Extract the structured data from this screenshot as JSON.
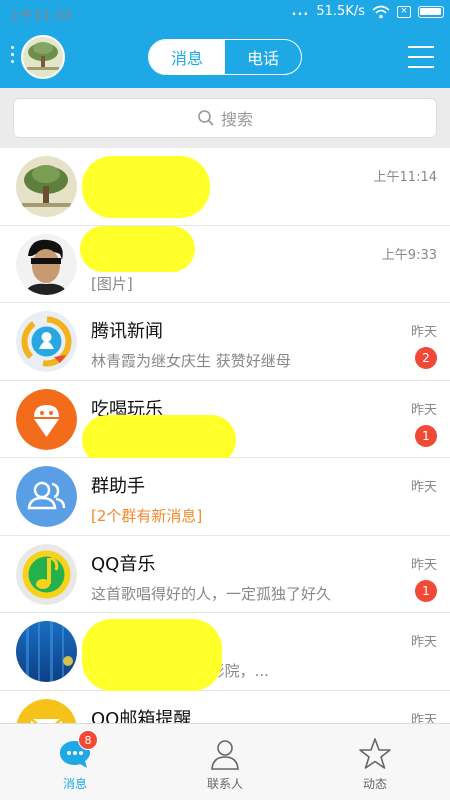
{
  "statusbar": {
    "time": "上午11:33",
    "dots": "...",
    "speed": "51.5K/s",
    "sim": "×"
  },
  "header": {
    "tabs": [
      {
        "label": "消息",
        "active": true
      },
      {
        "label": "电话",
        "active": false
      }
    ],
    "menu_icon": "menu-dots-icon",
    "more_icon": "hamburger-icon"
  },
  "search": {
    "placeholder": "搜索",
    "icon": "search-icon"
  },
  "conversations": [
    {
      "name": "",
      "preview": "",
      "time": "上午11:14",
      "badge": "",
      "avatar": "tree-avatar"
    },
    {
      "name": "",
      "preview": "[图片]",
      "time": "上午9:33",
      "badge": "",
      "avatar": "masked-man-avatar"
    },
    {
      "name": "腾讯新闻",
      "preview": "林青霞为继女庆生 获赞好继母",
      "time": "昨天",
      "badge": "2",
      "avatar": "tencent-news-avatar"
    },
    {
      "name": "吃喝玩乐",
      "preview": "",
      "time": "昨天",
      "badge": "1",
      "avatar": "ice-cream-avatar"
    },
    {
      "name": "群助手",
      "preview": "[2个群有新消息]",
      "time": "昨天",
      "badge": "",
      "avatar": "group-helper-avatar"
    },
    {
      "name": "QQ音乐",
      "preview": "这首歌唱得好的人，一定孤独了好久",
      "time": "昨天",
      "badge": "1",
      "avatar": "qq-music-avatar"
    },
    {
      "name": "",
      "preview": "2月13号一定别进影院，...",
      "time": "昨天",
      "badge": "",
      "avatar": "blue-avatar"
    },
    {
      "name": "QQ邮箱提醒",
      "preview": "",
      "time": "昨天",
      "badge": "",
      "avatar": "qq-mail-avatar"
    }
  ],
  "tabbar": {
    "tabs": [
      {
        "label": "消息",
        "active": true,
        "badge": "8",
        "icon": "chat-bubble-icon"
      },
      {
        "label": "联系人",
        "active": false,
        "icon": "contacts-icon"
      },
      {
        "label": "动态",
        "active": false,
        "icon": "star-icon"
      }
    ]
  },
  "colors": {
    "accent": "#1ea8e6",
    "badge": "#f04a36",
    "highlight": "#ffff2a",
    "orange_text": "#f08a2c"
  }
}
